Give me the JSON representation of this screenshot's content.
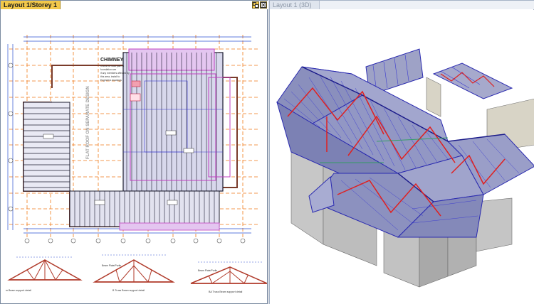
{
  "left_pane": {
    "title": "Layout 1/Storey 1",
    "buttons": [
      "tile-icon",
      "close-icon"
    ],
    "plan": {
      "heading": "CHIMNEY",
      "vertical_note": "FLAT ROOF ON SEPARATE DESIGN",
      "note_lines": [
        "Check for load path to",
        "foundation see",
        "if any members affected by",
        "this area, install to",
        "Engineers drawings"
      ]
    },
    "details": [
      {
        "caption": "m Beam support detail",
        "note": ""
      },
      {
        "caption": "B Truss Beam support detail",
        "note": "Beam Plate/Purlin"
      },
      {
        "caption": "BA Truss Beam support detail",
        "note": "Beam Plate/Purlin"
      }
    ]
  },
  "right_pane": {
    "title": "Layout 1 (3D)"
  },
  "colors": {
    "active_tab": "#f2c84a",
    "grid_dim": "#f07a1a",
    "member_dark": "#1c1c2e",
    "truss_blue": "#3a3ad0",
    "purlin_magenta": "#c040c0",
    "bracing_red": "#e02020",
    "wall_gray": "#b9b9b9"
  }
}
